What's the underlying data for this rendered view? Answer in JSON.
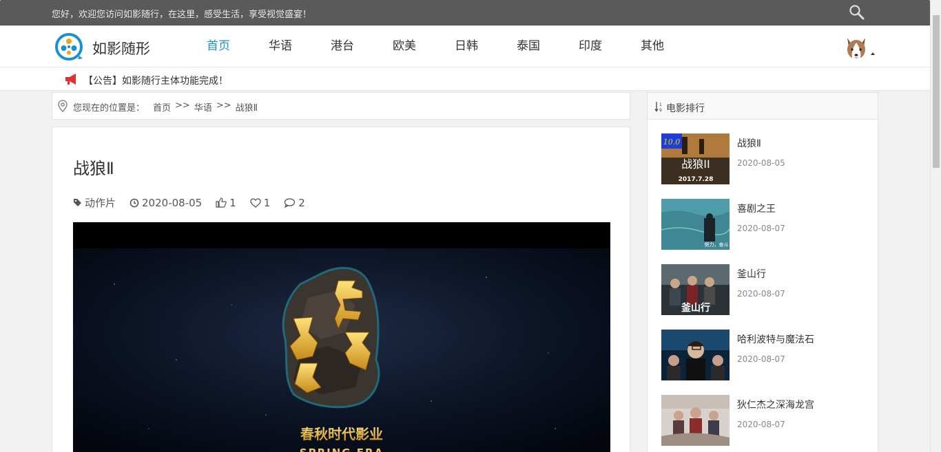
{
  "topbar": {
    "welcome": "您好，欢迎您访问如影随行，在这里，感受生活，享受视觉盛宴！"
  },
  "header": {
    "brand": "如影随形",
    "nav": [
      "首页",
      "华语",
      "港台",
      "欧美",
      "日韩",
      "泰国",
      "印度",
      "其他"
    ],
    "active_nav": 0
  },
  "notice": {
    "text": "【公告】如影随行主体功能完成！"
  },
  "breadcrumb": {
    "label": "您现在的位置是：",
    "items": [
      "首页",
      "华语",
      "战狼Ⅱ"
    ],
    "separator": ">>"
  },
  "article": {
    "title": "战狼Ⅱ",
    "category": "动作片",
    "date": "2020-08-05",
    "likes": "1",
    "favorites": "1",
    "comments": "2",
    "video": {
      "overlay_title": "春秋时代",
      "company_cn": "春秋时代影业",
      "company_en": "SPRING ERA"
    }
  },
  "sidebar": {
    "title": "电影排行",
    "items": [
      {
        "name": "战狼Ⅱ",
        "date": "2020-08-05",
        "score": "10.0",
        "poster_text": "战狼II",
        "poster_date": "2017.7.28"
      },
      {
        "name": "喜剧之王",
        "date": "2020-08-07",
        "poster_text": "努力，奋斗"
      },
      {
        "name": "釜山行",
        "date": "2020-08-07",
        "poster_text": "釜山行"
      },
      {
        "name": "哈利波特与魔法石",
        "date": "2020-08-07"
      },
      {
        "name": "狄仁杰之深海龙宫",
        "date": "2020-08-07"
      }
    ]
  },
  "colors": {
    "accent": "#1a8fd6",
    "topbar": "#5a5a5a",
    "notice_icon": "#e23131"
  }
}
